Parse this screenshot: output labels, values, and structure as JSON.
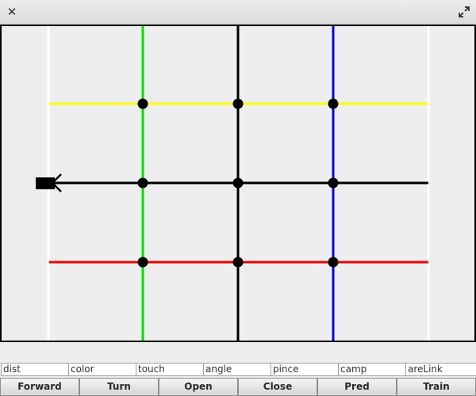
{
  "window": {
    "close_icon": "close-icon",
    "maximize_icon": "maximize-icon"
  },
  "colors": {
    "background": "#eeeeee",
    "border": "#000000",
    "white_line": "#ffffff",
    "green_line": "#00dd00",
    "black_line": "#000000",
    "blue_line": "#0000dd",
    "yellow_line": "#ffff00",
    "red_line": "#ee0000",
    "node": "#000000",
    "robot": "#000000"
  },
  "fields": [
    {
      "id": "dist",
      "value": "dist"
    },
    {
      "id": "color",
      "value": "color"
    },
    {
      "id": "touch",
      "value": "touch"
    },
    {
      "id": "angle",
      "value": "angle"
    },
    {
      "id": "pince",
      "value": "pince"
    },
    {
      "id": "camp",
      "value": "camp"
    },
    {
      "id": "arelink",
      "value": "areLink"
    }
  ],
  "buttons": {
    "forward": "Forward",
    "turn": "Turn",
    "open": "Open",
    "close": "Close",
    "pred": "Pred",
    "train": "Train"
  }
}
